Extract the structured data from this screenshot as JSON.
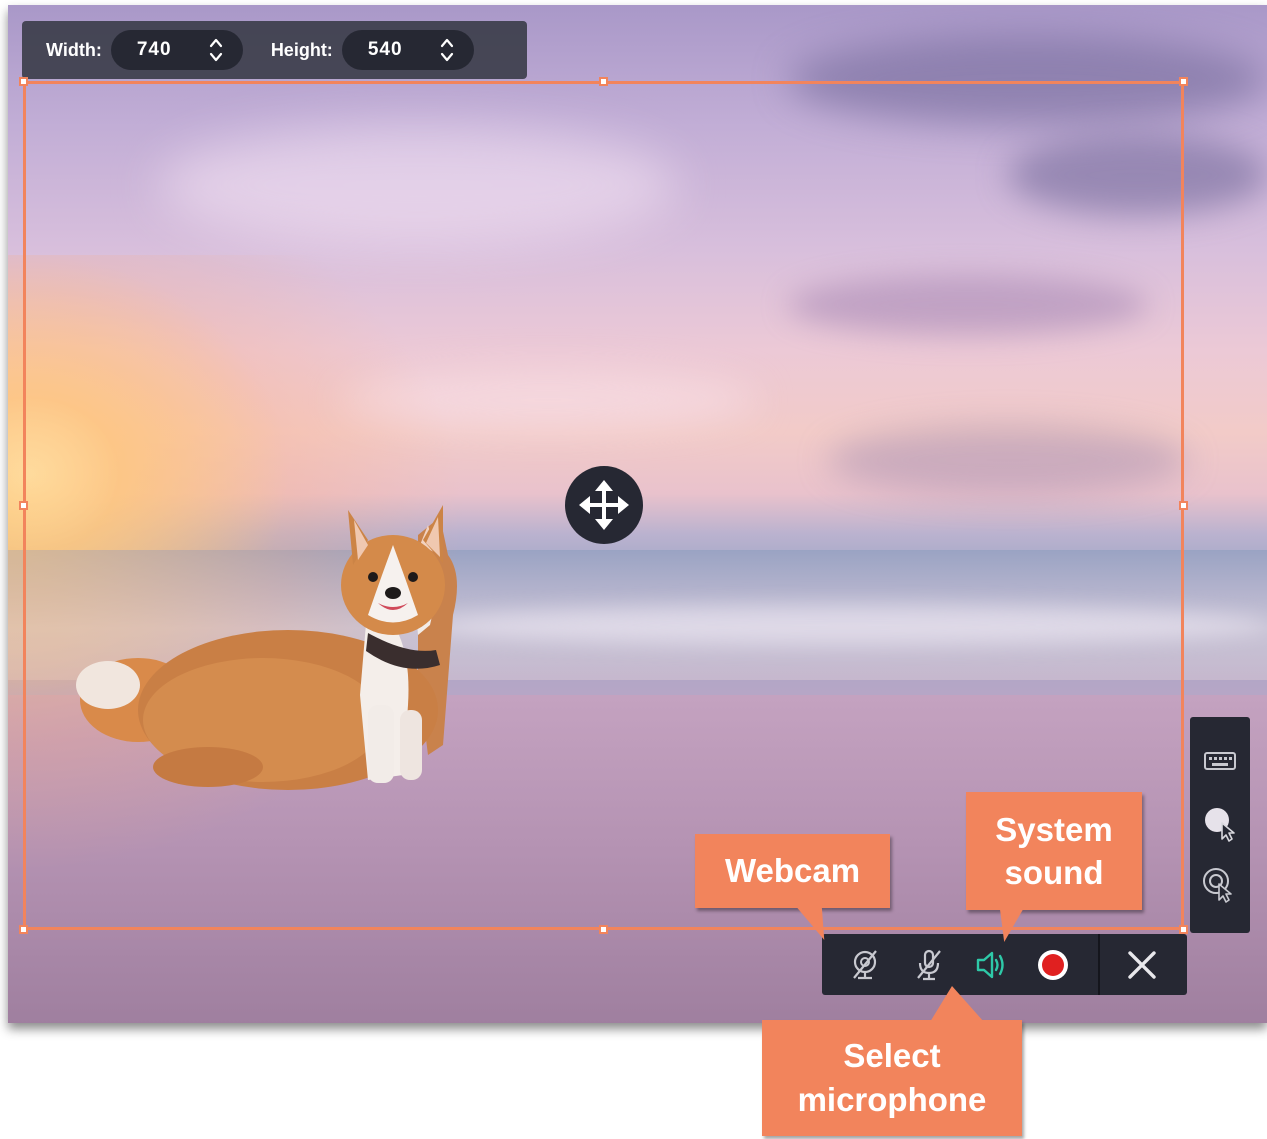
{
  "size_toolbar": {
    "width_label": "Width:",
    "width_value": "740",
    "height_label": "Height:",
    "height_value": "540"
  },
  "callouts": {
    "webcam": "Webcam",
    "system_sound_line1": "System",
    "system_sound_line2": "sound",
    "microphone_line1": "Select",
    "microphone_line2": "microphone"
  },
  "recording_toolbar": {
    "buttons": [
      "webcam-off-icon",
      "microphone-off-icon",
      "system-sound-icon",
      "record-icon",
      "close-icon"
    ]
  },
  "side_toolbar": {
    "buttons": [
      "keyboard-icon",
      "cursor-highlight-icon",
      "click-effect-icon"
    ]
  },
  "colors": {
    "frame_accent": "#f2845c",
    "toolbar_dark": "#262833",
    "sound_active": "#2ec9a8",
    "record_red": "#e02020"
  }
}
